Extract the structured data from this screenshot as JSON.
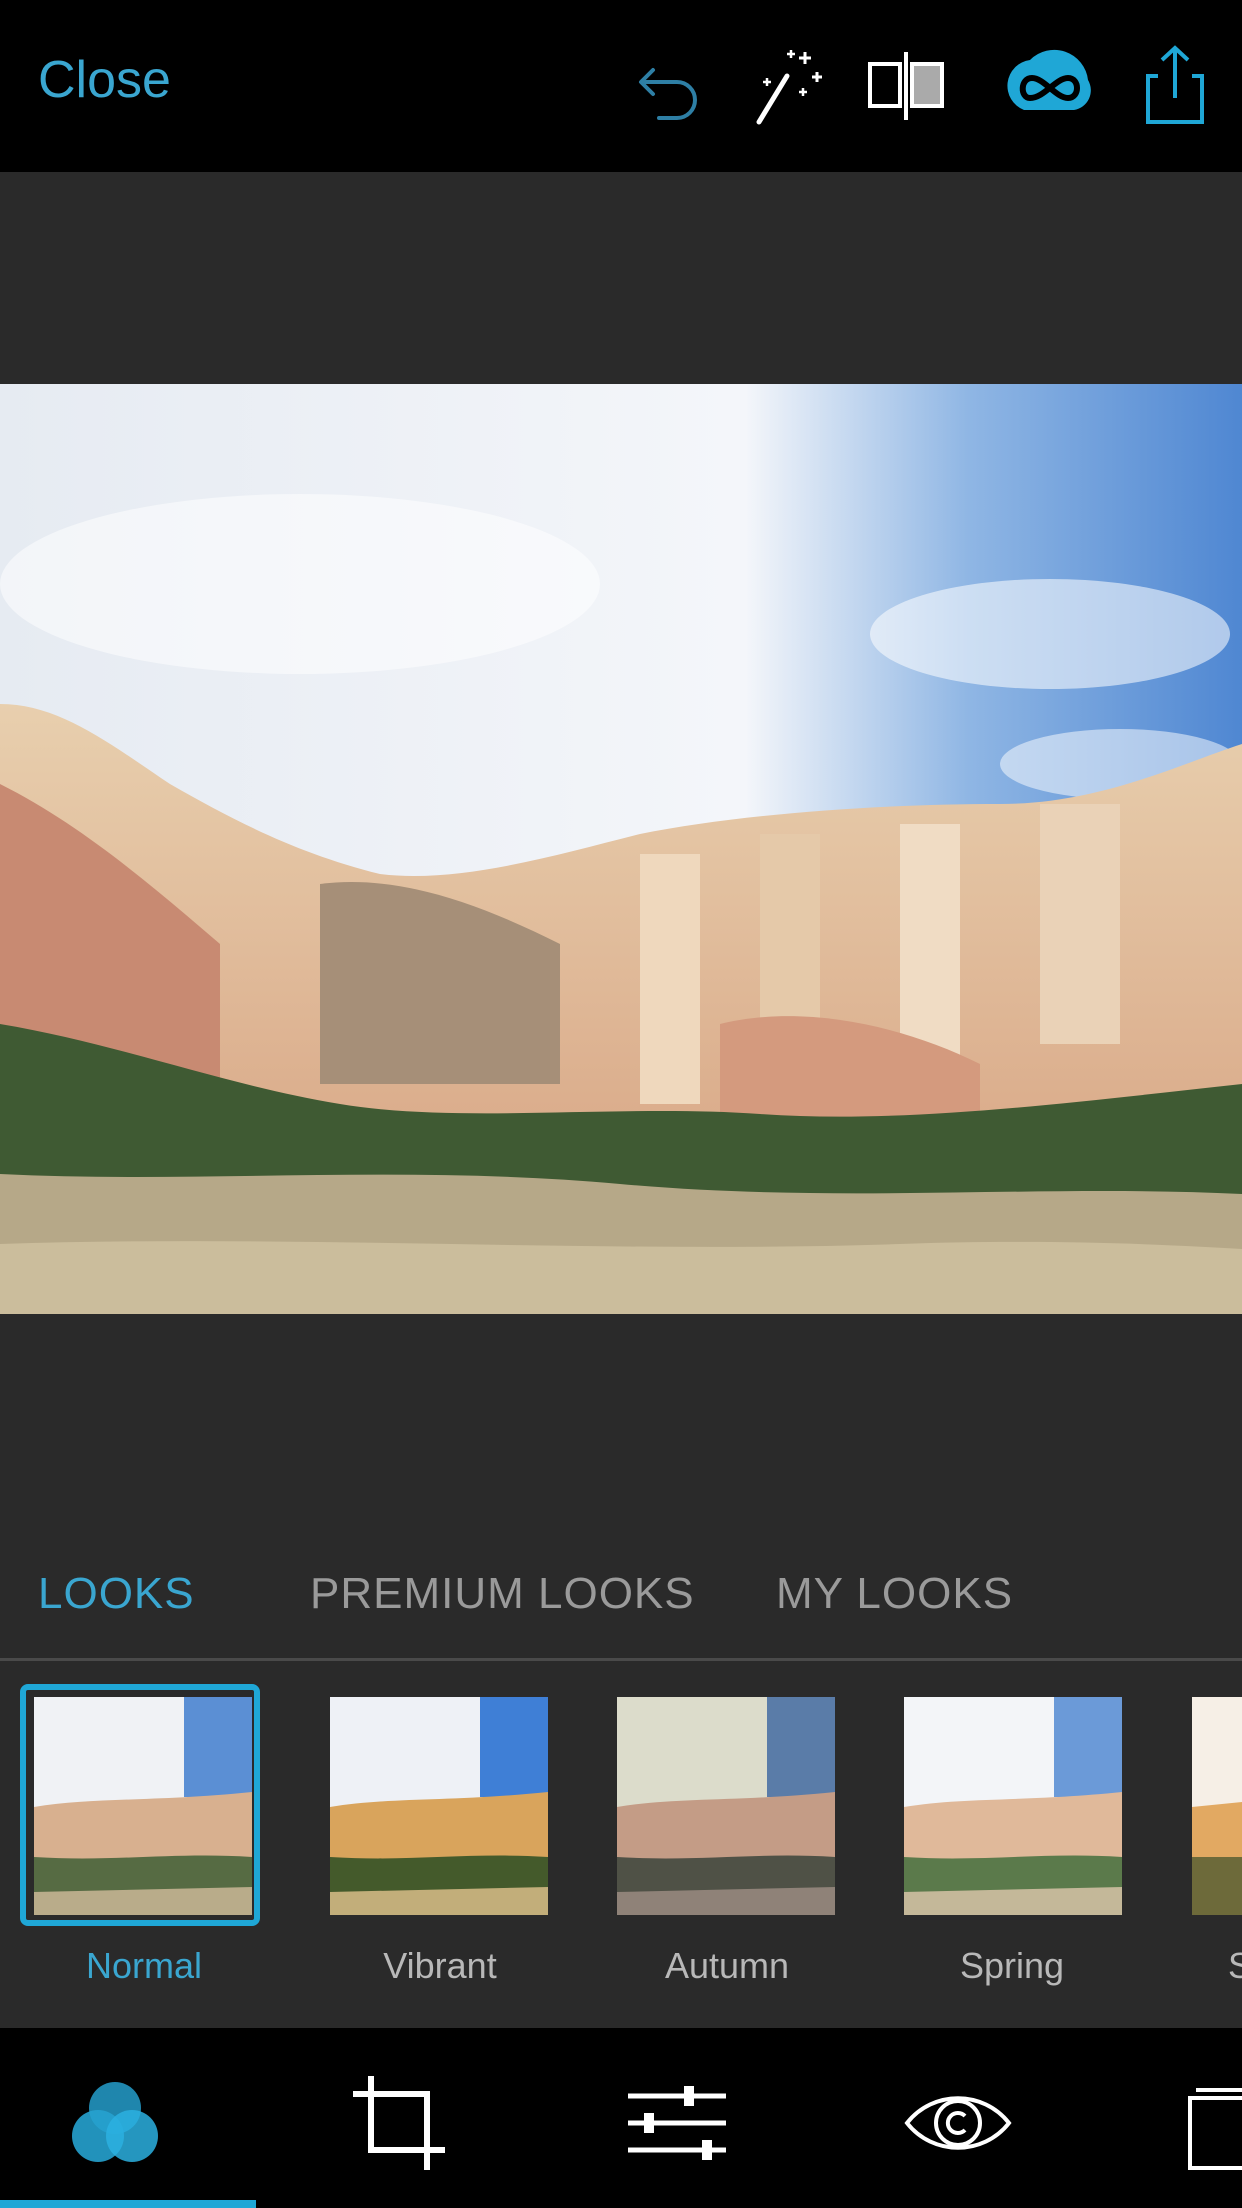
{
  "topbar": {
    "close_label": "Close",
    "icons": [
      "undo-icon",
      "auto-enhance-wand-icon",
      "compare-split-icon",
      "creative-cloud-icon",
      "share-icon"
    ]
  },
  "looks_tabs": [
    {
      "label": "LOOKS",
      "active": true
    },
    {
      "label": "PREMIUM LOOKS",
      "active": false
    },
    {
      "label": "MY LOOKS",
      "active": false
    }
  ],
  "looks": [
    {
      "label": "Normal",
      "selected": true
    },
    {
      "label": "Vibrant",
      "selected": false
    },
    {
      "label": "Autumn",
      "selected": false
    },
    {
      "label": "Spring",
      "selected": false
    },
    {
      "label": "S",
      "selected": false
    }
  ],
  "bottom_tools": [
    "looks-icon",
    "crop-icon",
    "adjustments-sliders-icon",
    "red-eye-icon",
    "borders-icon"
  ],
  "colors": {
    "accent": "#1fa7d6",
    "background": "#2a2a2a",
    "bar": "#000000"
  }
}
